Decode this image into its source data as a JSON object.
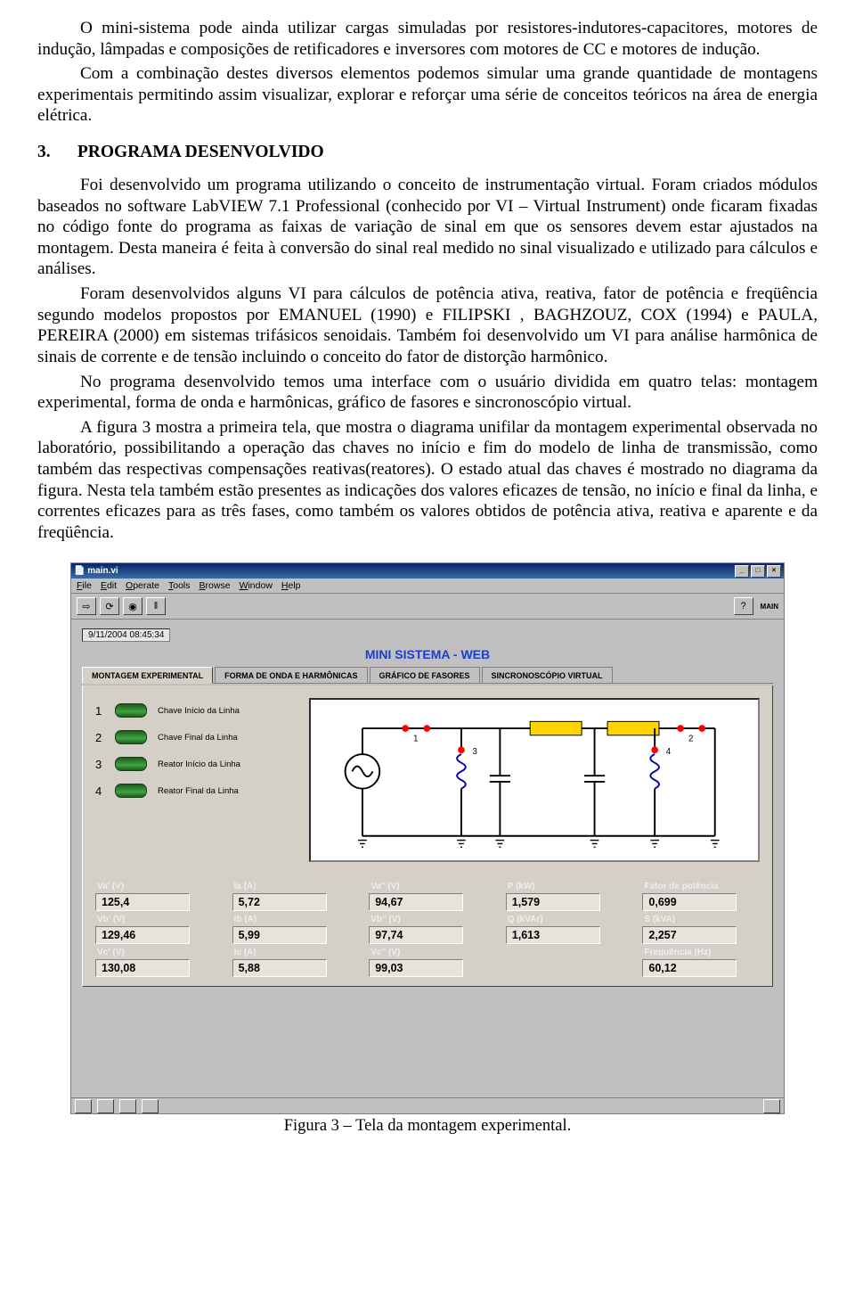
{
  "paragraphs": {
    "p1a": "O mini-sistema pode ainda utilizar cargas simuladas por resistores-indutores-capacitores, motores de indução, lâmpadas e composições de retificadores e inversores com motores de CC e motores de indução.",
    "p1b": "Com a combinação destes diversos elementos podemos simular uma grande quantidade de montagens experimentais permitindo assim visualizar, explorar e reforçar uma série de conceitos teóricos na área de energia elétrica.",
    "sec_num": "3.",
    "sec_title": "PROGRAMA DESENVOLVIDO",
    "p2": "Foi desenvolvido um programa utilizando o conceito de instrumentação virtual. Foram criados módulos baseados no software LabVIEW 7.1 Professional (conhecido por VI – Virtual Instrument) onde ficaram fixadas no código fonte do programa as faixas de variação de sinal em que os sensores devem estar ajustados na montagem. Desta maneira é feita à conversão do sinal real medido no sinal visualizado e utilizado para cálculos e análises.",
    "p3": "Foram desenvolvidos alguns VI para cálculos de potência ativa, reativa, fator de potência e freqüência segundo modelos propostos por EMANUEL (1990) e FILIPSKI , BAGHZOUZ, COX (1994) e PAULA, PEREIRA (2000) em sistemas trifásicos senoidais. Também foi desenvolvido um VI para análise harmônica de sinais de corrente e de tensão incluindo o conceito do fator de distorção harmônico.",
    "p4": "No programa desenvolvido temos uma interface com o usuário dividida em quatro telas: montagem experimental, forma de onda e harmônicas, gráfico de fasores e sincronoscópio virtual.",
    "p5": "A figura 3 mostra a primeira tela, que mostra o diagrama unifilar da montagem experimental observada no laboratório, possibilitando a operação das chaves no início e fim do modelo de linha de transmissão, como também das respectivas compensações reativas(reatores). O estado atual das chaves é mostrado no diagrama da figura. Nesta tela também estão presentes as indicações dos valores eficazes de tensão, no início e final da linha, e correntes eficazes para as três fases, como também os valores obtidos de potência ativa, reativa e aparente e da freqüência.",
    "figcap": "Figura 3 – Tela da montagem experimental."
  },
  "labview": {
    "window_title": "main.vi",
    "menu": {
      "file": "File",
      "edit": "Edit",
      "operate": "Operate",
      "tools": "Tools",
      "browse": "Browse",
      "window": "Window",
      "help": "Help"
    },
    "main_label": "MAIN",
    "datetime": "9/11/2004 08:45:34",
    "app_title": "MINI SISTEMA - WEB",
    "tabs": {
      "t1": "MONTAGEM EXPERIMENTAL",
      "t2": "FORMA DE ONDA E HARMÔNICAS",
      "t3": "GRÁFICO DE FASORES",
      "t4": "SINCRONOSCÓPIO VIRTUAL"
    },
    "switches": {
      "s1": {
        "n": "1",
        "label": "Chave Início da Linha"
      },
      "s2": {
        "n": "2",
        "label": "Chave Final da Linha"
      },
      "s3": {
        "n": "3",
        "label": "Reator Início da Linha"
      },
      "s4": {
        "n": "4",
        "label": "Reator Final da Linha"
      }
    },
    "readouts": {
      "va1": {
        "label": "Va' (V)",
        "value": "125,4"
      },
      "ia": {
        "label": "Ia (A)",
        "value": "5,72"
      },
      "va2": {
        "label": "Va'' (V)",
        "value": "94,67"
      },
      "p": {
        "label": "P (kW)",
        "value": "1,579"
      },
      "fp": {
        "label": "Fator de potência",
        "value": "0,699"
      },
      "vb1": {
        "label": "Vb' (V)",
        "value": "129,46"
      },
      "ib": {
        "label": "Ib (A)",
        "value": "5,99"
      },
      "vb2": {
        "label": "Vb'' (V)",
        "value": "97,74"
      },
      "q": {
        "label": "Q (kVAr)",
        "value": "1,613"
      },
      "s": {
        "label": "S (kVA)",
        "value": "2,257"
      },
      "vc1": {
        "label": "Vc' (V)",
        "value": "130,08"
      },
      "ic": {
        "label": "Ic (A)",
        "value": "5,88"
      },
      "vc2": {
        "label": "Vc'' (V)",
        "value": "99,03"
      },
      "freq": {
        "label": "Frequência (Hz)",
        "value": "60,12"
      }
    }
  }
}
